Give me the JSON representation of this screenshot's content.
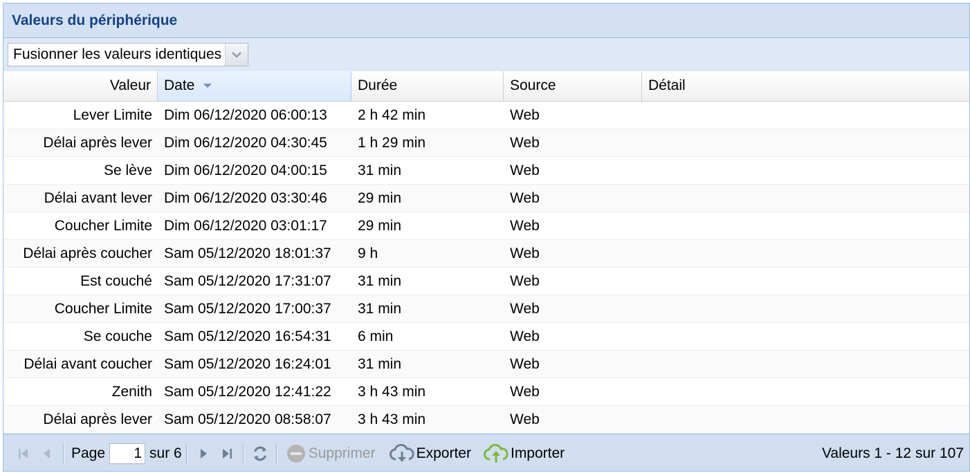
{
  "panel": {
    "title": "Valeurs du périphérique"
  },
  "toolbar": {
    "combo_value": "Fusionner les valeurs identiques"
  },
  "grid": {
    "columns": [
      "Valeur",
      "Date",
      "Durée",
      "Source",
      "Détail"
    ],
    "sort_column": "Date",
    "rows": [
      [
        "Lever Limite",
        "Dim 06/12/2020 06:00:13",
        "2 h 42 min",
        "Web",
        ""
      ],
      [
        "Délai après lever",
        "Dim 06/12/2020 04:30:45",
        "1 h 29 min",
        "Web",
        ""
      ],
      [
        "Se lève",
        "Dim 06/12/2020 04:00:15",
        "31 min",
        "Web",
        ""
      ],
      [
        "Délai avant lever",
        "Dim 06/12/2020 03:30:46",
        "29 min",
        "Web",
        ""
      ],
      [
        "Coucher Limite",
        "Dim 06/12/2020 03:01:17",
        "29 min",
        "Web",
        ""
      ],
      [
        "Délai après coucher",
        "Sam 05/12/2020 18:01:37",
        "9 h",
        "Web",
        ""
      ],
      [
        "Est couché",
        "Sam 05/12/2020 17:31:07",
        "31 min",
        "Web",
        ""
      ],
      [
        "Coucher Limite",
        "Sam 05/12/2020 17:00:37",
        "31 min",
        "Web",
        ""
      ],
      [
        "Se couche",
        "Sam 05/12/2020 16:54:31",
        "6 min",
        "Web",
        ""
      ],
      [
        "Délai avant coucher",
        "Sam 05/12/2020 16:24:01",
        "31 min",
        "Web",
        ""
      ],
      [
        "Zenith",
        "Sam 05/12/2020 12:41:22",
        "3 h 43 min",
        "Web",
        ""
      ],
      [
        "Délai après lever",
        "Sam 05/12/2020 08:58:07",
        "3 h 43 min",
        "Web",
        ""
      ]
    ]
  },
  "pager": {
    "page_label": "Page",
    "page_value": "1",
    "of_label": "sur 6",
    "delete_label": "Supprimer",
    "export_label": "Exporter",
    "import_label": "Importer",
    "status": "Valeurs 1 - 12 sur 107"
  },
  "colors": {
    "title": "#15428b",
    "header_bg": "#d4e1f2",
    "border": "#99bbe8",
    "import_icon": "#7cbb37"
  }
}
